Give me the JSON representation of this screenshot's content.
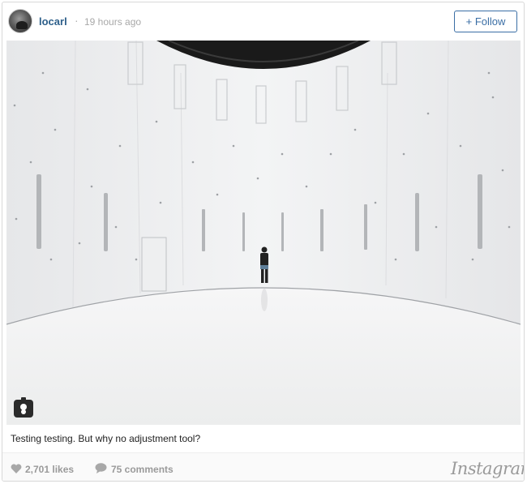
{
  "post": {
    "username": "locarl",
    "separator": "·",
    "timestamp": "19 hours ago",
    "follow_label": "+ Follow",
    "caption": "Testing testing. But why no adjustment tool?",
    "likes": "2,701 likes",
    "comments": "75 comments",
    "brand": "Instagram"
  },
  "colors": {
    "username": "#2d5f8a",
    "follow_accent": "#3a6ea5",
    "muted_text": "#9a9a9a"
  },
  "icons": [
    "avatar",
    "user-tag-icon",
    "heart-icon",
    "comment-icon"
  ]
}
